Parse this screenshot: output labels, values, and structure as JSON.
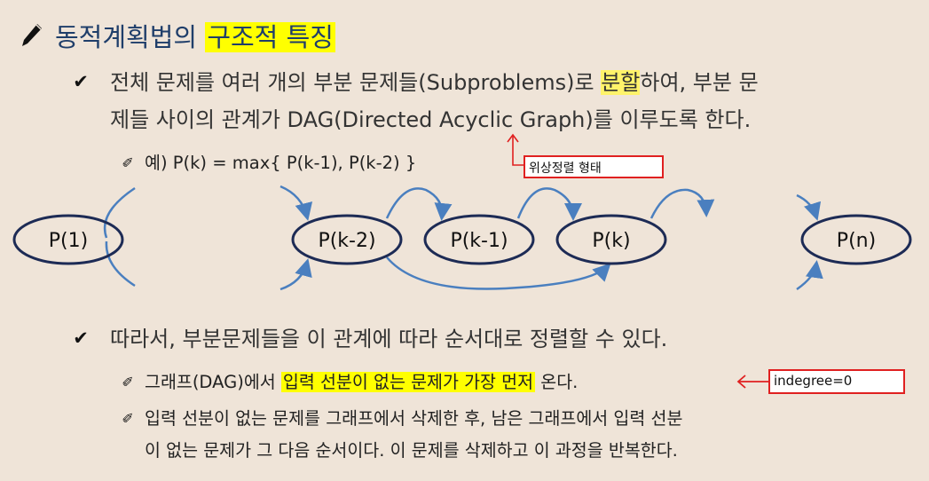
{
  "title": {
    "icon": "pencil-icon",
    "text_plain": "동적계획법의 ",
    "text_highlight": "구조적 특징"
  },
  "bullet1": {
    "icon": "checkmark-icon",
    "line1_a": "전체 문제를 여러 개의 부분 문제들(Subproblems)로 ",
    "line1_highlight": "분할",
    "line1_b": "하여, 부분 문",
    "line2": "제들 사이의 관계가 DAG(Directed Acyclic Graph)를 이루도록 한다."
  },
  "example": {
    "icon": "pin-icon",
    "text": "예) P(k) = max{ P(k-1), P(k-2) }"
  },
  "topo_note": "위상정렬 형태",
  "diagram": {
    "nodes": [
      "P(1)",
      "P(k-2)",
      "P(k-1)",
      "P(k)",
      "P(n)"
    ],
    "edge_color": "#4a7fbf",
    "node_stroke": "#1d2b55"
  },
  "bullet2": {
    "icon": "checkmark-icon",
    "text": "따라서, 부분문제들을 이 관계에 따라 순서대로 정렬할 수 있다."
  },
  "sub1": {
    "icon": "pin-icon",
    "text_a": "그래프(DAG)에서 ",
    "text_highlight": "입력 선분이 없는 문제가 가장 먼저",
    "text_b": " 온다."
  },
  "indegree_note": "indegree=0",
  "sub2": {
    "icon": "pin-icon",
    "line1": "입력 선분이 없는 문제를 그래프에서 삭제한 후, 남은 그래프에서 입력 선분",
    "line2": "이 없는 문제가 그 다음 순서이다. 이 문제를 삭제하고 이 과정을 반복한다."
  },
  "colors": {
    "background": "#efe4d8",
    "title": "#1f3e6a",
    "highlight": "#ffff00",
    "annotation_red": "#e02020",
    "arrow_blue": "#4a7fbf"
  }
}
